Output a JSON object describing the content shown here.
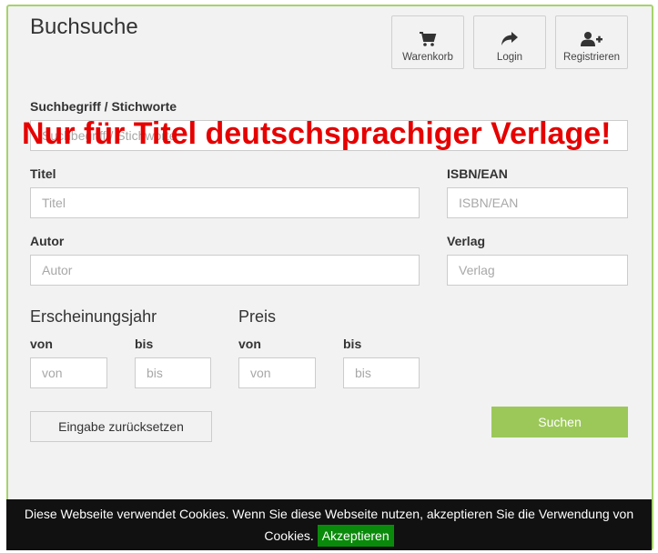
{
  "header": {
    "title": "Buchsuche",
    "nav": [
      {
        "label": "Warenkorb",
        "icon": "cart-icon"
      },
      {
        "label": "Login",
        "icon": "share-arrow-icon"
      },
      {
        "label": "Registrieren",
        "icon": "add-user-icon"
      }
    ]
  },
  "form": {
    "keyword": {
      "label": "Suchbegriff / Stichworte",
      "placeholder": "Suchbegriff / Stichworte"
    },
    "notice": "Nur für Titel deutschsprachiger Verlage!",
    "title_field": {
      "label": "Titel",
      "placeholder": "Titel"
    },
    "isbn": {
      "label": "ISBN/EAN",
      "placeholder": "ISBN/EAN"
    },
    "author": {
      "label": "Autor",
      "placeholder": "Autor"
    },
    "publisher": {
      "label": "Verlag",
      "placeholder": "Verlag"
    },
    "year": {
      "heading": "Erscheinungsjahr",
      "from_label": "von",
      "from_placeholder": "von",
      "to_label": "bis",
      "to_placeholder": "bis"
    },
    "price": {
      "heading": "Preis",
      "from_label": "von",
      "from_placeholder": "von",
      "to_label": "bis",
      "to_placeholder": "bis"
    },
    "reset_label": "Eingabe zurücksetzen",
    "search_label": "Suchen"
  },
  "cookie": {
    "text": "Diese Webseite verwendet Cookies. Wenn Sie diese Webseite nutzen, akzeptieren Sie die Verwendung von Cookies.",
    "accept_label": "Akzeptieren"
  },
  "colors": {
    "accent_green": "#9cc85a",
    "frame_border": "#a6d36b",
    "notice_red": "#e60000",
    "cookie_bg": "#111111",
    "accept_bg": "#0a8a0a"
  }
}
